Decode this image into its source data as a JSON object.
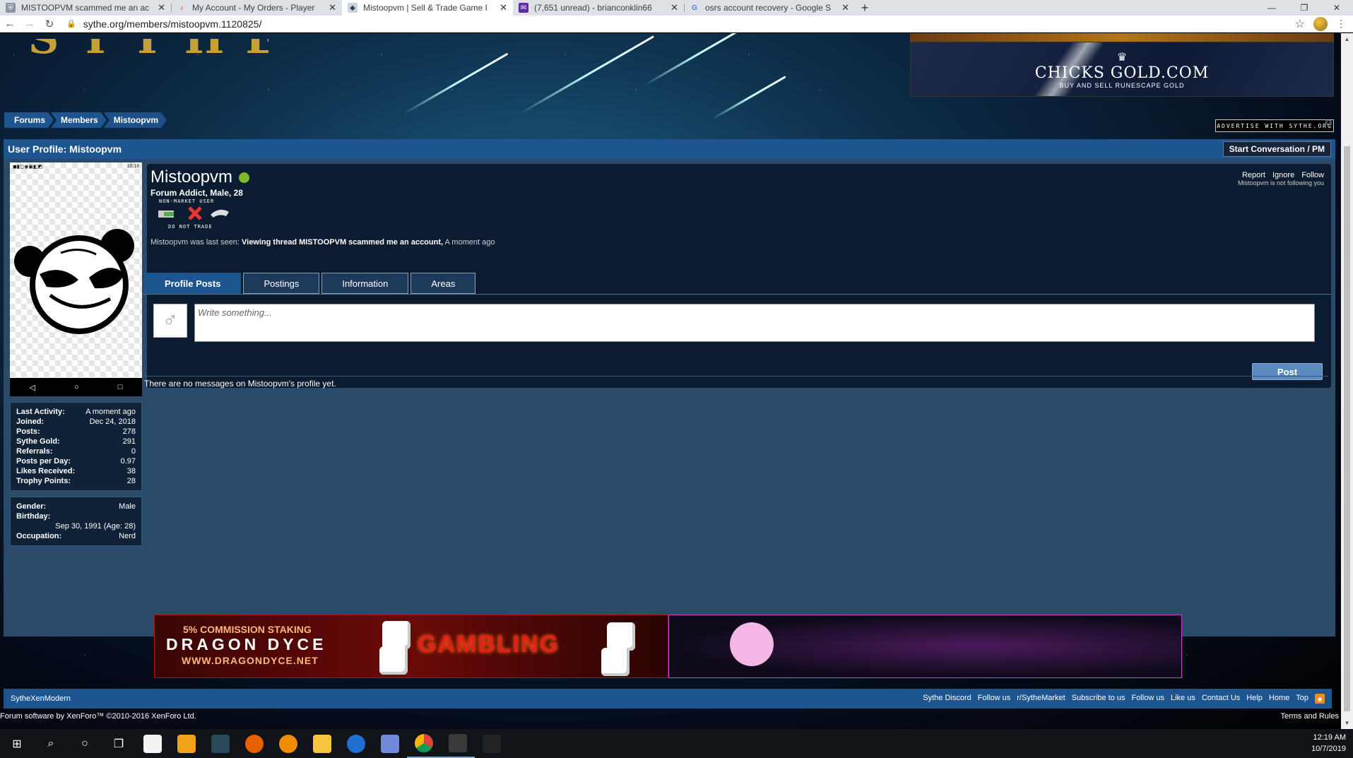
{
  "browser": {
    "tabs": [
      {
        "title": "MISTOOPVM scammed me an ac",
        "favicon": "shield-icon",
        "active": false
      },
      {
        "title": "My Account - My Orders - Player",
        "favicon": "player-logo-icon",
        "active": false
      },
      {
        "title": "Mistoopvm | Sell & Trade Game I",
        "favicon": "sythe-icon",
        "active": true
      },
      {
        "title": "(7,651 unread) - brianconklin66",
        "favicon": "mail-icon",
        "active": false
      },
      {
        "title": "osrs account recovery - Google S",
        "favicon": "google-icon",
        "active": false
      }
    ],
    "url": "sythe.org/members/mistoopvm.1120825/"
  },
  "header": {
    "ad": {
      "brand": "CHICKS GOLD.COM",
      "tagline": "BUY AND SELL RUNESCAPE GOLD",
      "advertise_link": "ADVERTISE WITH SYTHE.ORG"
    },
    "breadcrumb": [
      "Forums",
      "Members",
      "Mistoopvm"
    ]
  },
  "profile": {
    "page_title": "User Profile: Mistoopvm",
    "start_conversation": "Start Conversation / PM",
    "name": "Mistoopvm",
    "subtitle": "Forum Addict, Male, 28",
    "badges": {
      "top_caption": "NON-MARKET USER",
      "bottom_caption": "DO NOT TRADE"
    },
    "last_seen_prefix": "Mistoopvm was last seen:",
    "last_seen_activity": "Viewing thread MISTOOPVM scammed me an account,",
    "last_seen_time": "A moment ago",
    "actions": {
      "report": "Report",
      "ignore": "Ignore",
      "follow": "Follow",
      "note": "Mistoopvm is not following you"
    },
    "tabs": [
      "Profile Posts",
      "Postings",
      "Information",
      "Areas"
    ],
    "post_placeholder": "Write something...",
    "post_button": "Post",
    "no_messages": "There are no messages on Mistoopvm's profile yet.",
    "avatar_status_time": "10:18",
    "stats": [
      {
        "label": "Last Activity:",
        "value": "A moment ago"
      },
      {
        "label": "Joined:",
        "value": "Dec 24, 2018"
      },
      {
        "label": "Posts:",
        "value": "278"
      },
      {
        "label": "Sythe Gold:",
        "value": "291"
      },
      {
        "label": "Referrals:",
        "value": "0"
      },
      {
        "label": "Posts per Day:",
        "value": "0.97"
      },
      {
        "label": "Likes Received:",
        "value": "38"
      },
      {
        "label": "Trophy Points:",
        "value": "28"
      }
    ],
    "personal": {
      "gender_label": "Gender:",
      "gender": "Male",
      "birthday_label": "Birthday:",
      "birthday": "Sep 30, 1991 (Age: 28)",
      "occupation_label": "Occupation:",
      "occupation": "Nerd"
    }
  },
  "banners": {
    "dragondyce": {
      "line1": "5% COMMISSION STAKING",
      "line2": "DRAGON DYCE",
      "line3": "WWW.DRAGONDYCE.NET",
      "headline": "GAMBLING"
    }
  },
  "footer": {
    "style_name": "SytheXenModern",
    "links": [
      "Sythe Discord",
      "Follow us",
      "r/SytheMarket",
      "Subscribe to us",
      "Follow us",
      "Like us",
      "Contact Us",
      "Help",
      "Home",
      "Top"
    ],
    "copyright": "Forum software by XenForo™ ©2010-2016 XenForo Ltd.",
    "terms": "Terms and Rules"
  },
  "taskbar": {
    "time": "12:19 AM",
    "date": "10/7/2019"
  },
  "colors": {
    "accent": "#1d5591",
    "online": "#7cba2a",
    "panel": "#0c1c30"
  }
}
